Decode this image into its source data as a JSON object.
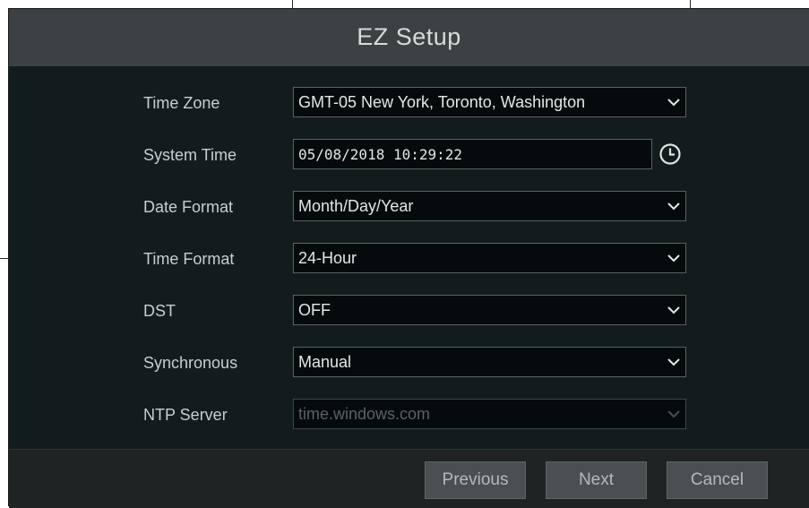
{
  "dialog": {
    "title": "EZ Setup"
  },
  "fields": [
    {
      "label": "Time Zone",
      "value": "GMT-05 New York, Toronto, Washington",
      "control": "select"
    },
    {
      "label": "System Time",
      "value": "05/08/2018 10:29:22",
      "control": "datetime"
    },
    {
      "label": "Date Format",
      "value": "Month/Day/Year",
      "control": "select"
    },
    {
      "label": "Time Format",
      "value": "24-Hour",
      "control": "select"
    },
    {
      "label": "DST",
      "value": "OFF",
      "control": "select"
    },
    {
      "label": "Synchronous",
      "value": "Manual",
      "control": "select"
    },
    {
      "label": "NTP Server",
      "value": "time.windows.com",
      "control": "select",
      "disabled": true
    }
  ],
  "buttons": {
    "previous": "Previous",
    "next": "Next",
    "cancel": "Cancel"
  },
  "icons": {
    "clock": "clock-icon",
    "dropdown": "chevron-down-icon"
  },
  "colors": {
    "title_bar": "#3c4243",
    "panel": "#121c1d",
    "field_bg": "#050b0c",
    "button": "#4a5051",
    "text": "#c9cecf"
  }
}
